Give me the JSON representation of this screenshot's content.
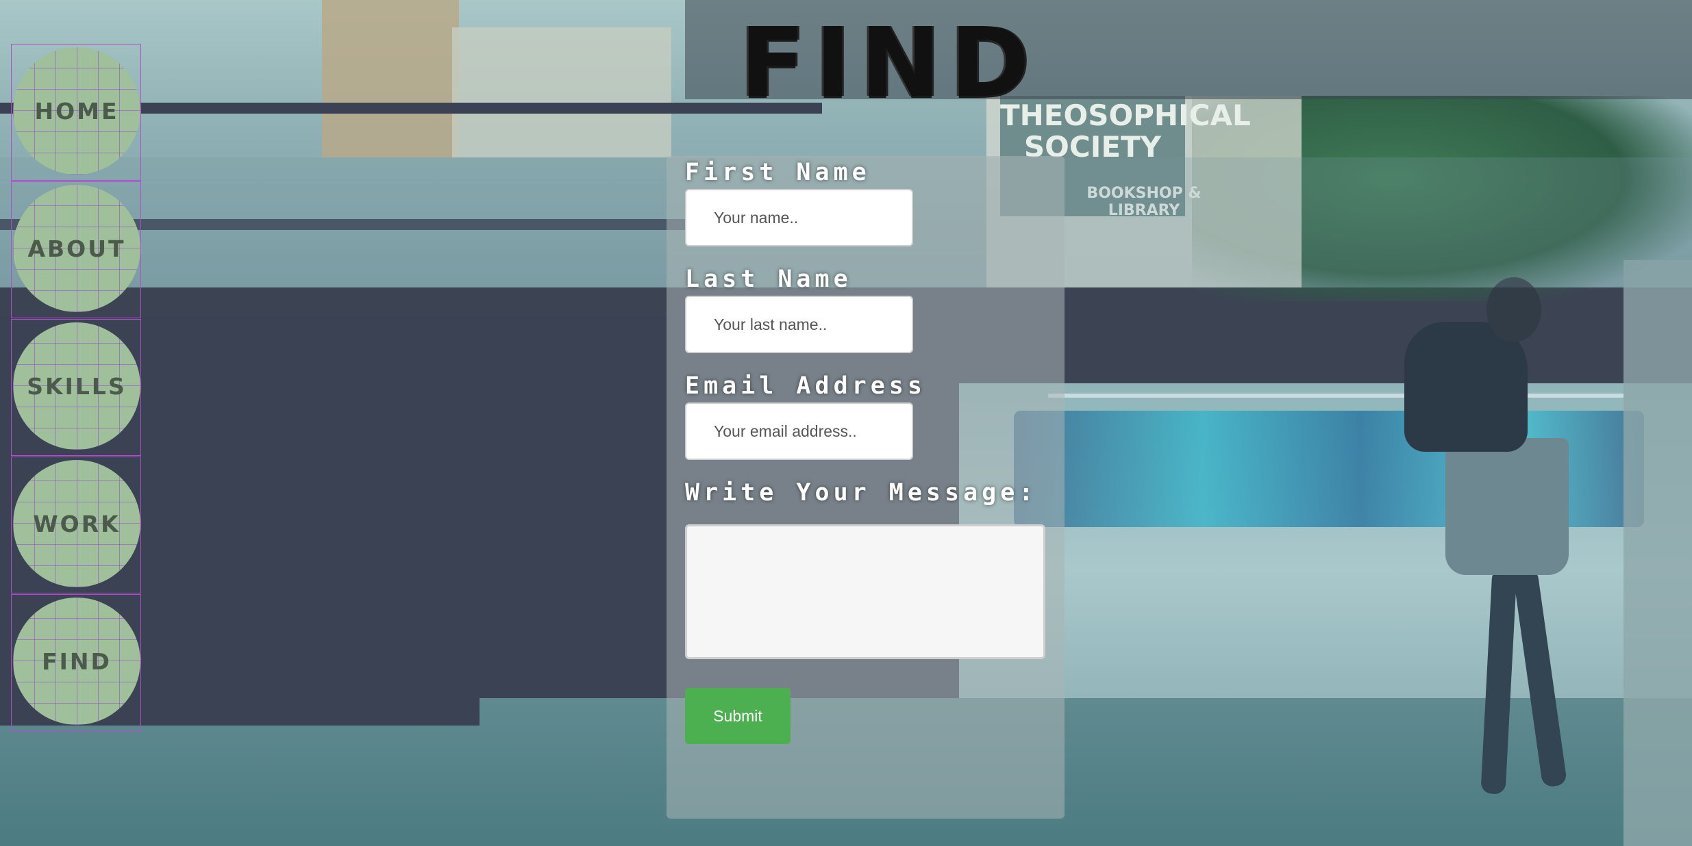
{
  "title": "FIND",
  "background": {
    "sign_text": "THEOSOPHICAL SOCIETY",
    "bookshop_text": "BOOKSHOP & LIBRARY"
  },
  "nav": {
    "items": [
      {
        "label": "HOME"
      },
      {
        "label": "ABOUT"
      },
      {
        "label": "SKILLS"
      },
      {
        "label": "WORK"
      },
      {
        "label": "FIND"
      }
    ]
  },
  "form": {
    "first_name_label": "First Name",
    "first_name_placeholder": "Your name..",
    "last_name_label": "Last Name",
    "last_name_placeholder": "Your last name..",
    "email_label": "Email Address",
    "email_placeholder": "Your email address..",
    "message_label": "Write Your Message:",
    "submit_label": "Submit"
  },
  "colors": {
    "nav_circle": "#9fc09a",
    "submit": "#4caf50",
    "nav_border": "#b44ad0"
  }
}
